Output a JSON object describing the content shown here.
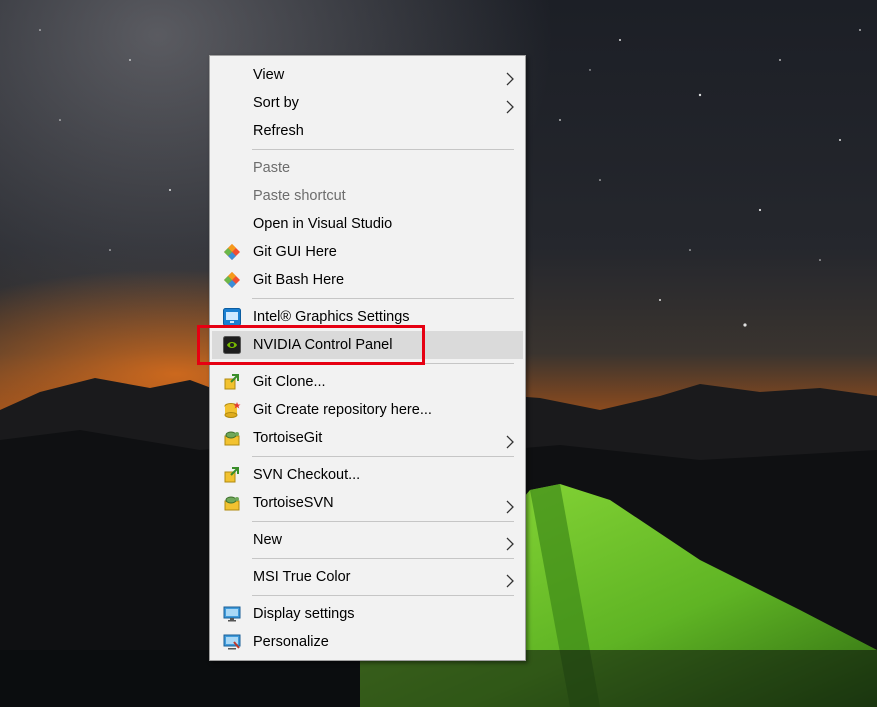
{
  "colors": {
    "menu_background": "#f2f2f2",
    "menu_border": "#a0a0a0",
    "highlight_row": "#dadada",
    "annotation_box": "#e60012",
    "disabled_text": "#6d6d6d"
  },
  "desktop": {
    "wallpaper": "night-sky-mountains-green-tent"
  },
  "menu": {
    "items": [
      {
        "label": "View",
        "icon": null,
        "submenu": true,
        "disabled": false
      },
      {
        "label": "Sort by",
        "icon": null,
        "submenu": true,
        "disabled": false
      },
      {
        "label": "Refresh",
        "icon": null,
        "submenu": false,
        "disabled": false
      },
      {
        "label": "Paste",
        "icon": null,
        "submenu": false,
        "disabled": true
      },
      {
        "label": "Paste shortcut",
        "icon": null,
        "submenu": false,
        "disabled": true
      },
      {
        "label": "Open in Visual Studio",
        "icon": null,
        "submenu": false,
        "disabled": false
      },
      {
        "label": "Git GUI Here",
        "icon": "git-diamond-icon",
        "submenu": false,
        "disabled": false
      },
      {
        "label": "Git Bash Here",
        "icon": "git-diamond-icon",
        "submenu": false,
        "disabled": false
      },
      {
        "label": "Intel® Graphics Settings",
        "icon": "intel-graphics-icon",
        "submenu": false,
        "disabled": false
      },
      {
        "label": "NVIDIA Control Panel",
        "icon": "nvidia-icon",
        "submenu": false,
        "disabled": false,
        "highlighted": true
      },
      {
        "label": "Git Clone...",
        "icon": "tortoisegit-clone-icon",
        "submenu": false,
        "disabled": false
      },
      {
        "label": "Git Create repository here...",
        "icon": "tortoisegit-create-repo-icon",
        "submenu": false,
        "disabled": false
      },
      {
        "label": "TortoiseGit",
        "icon": "tortoisegit-icon",
        "submenu": true,
        "disabled": false
      },
      {
        "label": "SVN Checkout...",
        "icon": "svn-checkout-icon",
        "submenu": false,
        "disabled": false
      },
      {
        "label": "TortoiseSVN",
        "icon": "tortoisesvn-icon",
        "submenu": true,
        "disabled": false
      },
      {
        "label": "New",
        "icon": null,
        "submenu": true,
        "disabled": false
      },
      {
        "label": "MSI True Color",
        "icon": null,
        "submenu": true,
        "disabled": false
      },
      {
        "label": "Display settings",
        "icon": "display-settings-icon",
        "submenu": false,
        "disabled": false
      },
      {
        "label": "Personalize",
        "icon": "personalize-icon",
        "submenu": false,
        "disabled": false
      }
    ]
  },
  "annotation": {
    "target": "NVIDIA Control Panel"
  }
}
